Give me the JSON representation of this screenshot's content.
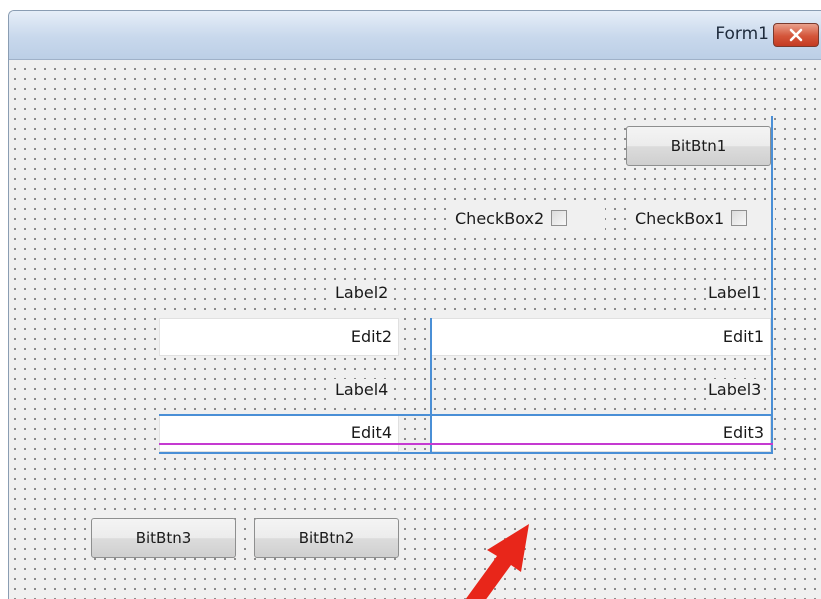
{
  "window": {
    "title": "Form1"
  },
  "buttons": {
    "bitbtn1": "BitBtn1",
    "bitbtn2": "BitBtn2",
    "bitbtn3": "BitBtn3"
  },
  "checkboxes": {
    "checkbox1": "CheckBox1",
    "checkbox2": "CheckBox2"
  },
  "labels": {
    "label1": "Label1",
    "label2": "Label2",
    "label3": "Label3",
    "label4": "Label4"
  },
  "edits": {
    "edit1": "Edit1",
    "edit2": "Edit2",
    "edit3": "Edit3",
    "edit4": "Edit4"
  },
  "icons": {
    "close": "close-icon",
    "annotation": "red-arrow-icon"
  },
  "colors": {
    "guide": "#4a8fd6",
    "baseline_guide": "#c53ad1",
    "arrow": "#e8261a"
  }
}
